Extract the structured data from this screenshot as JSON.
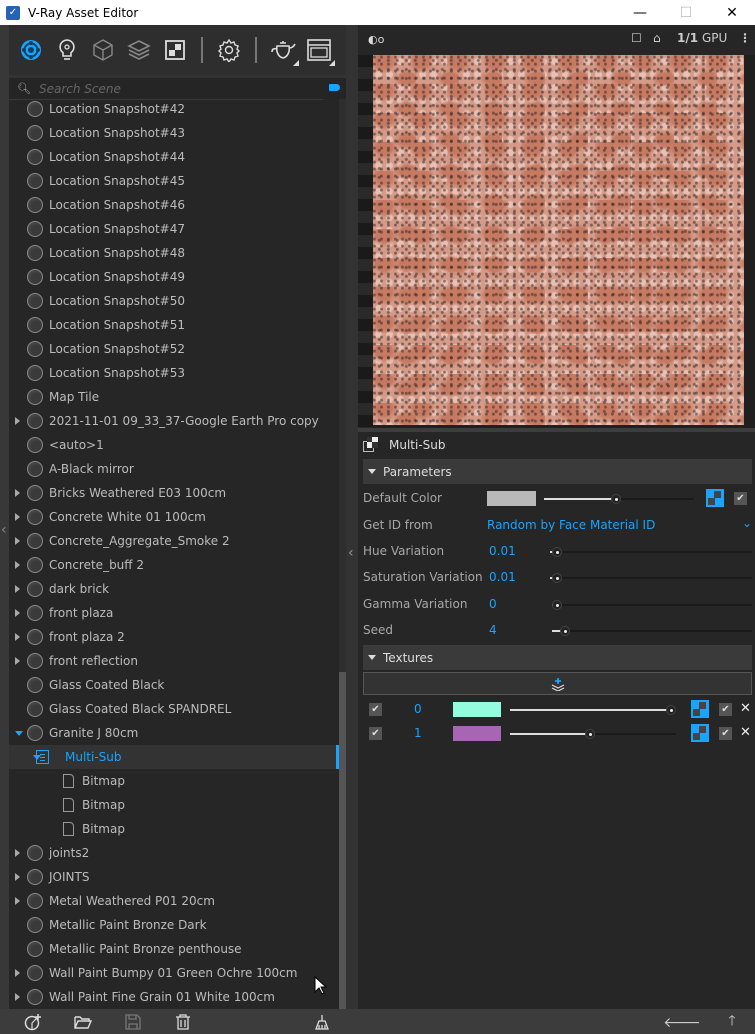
{
  "window": {
    "title": "V-Ray Asset Editor",
    "app_icon": "vray-logo-icon",
    "controls": [
      "minimize",
      "maximize",
      "close"
    ]
  },
  "toolbar": {
    "items": [
      {
        "name": "materials",
        "icon": "materials-icon",
        "active": true
      },
      {
        "name": "lights",
        "icon": "light-bulb-icon"
      },
      {
        "name": "geometry",
        "icon": "cube-icon"
      },
      {
        "name": "render-elements",
        "icon": "layers-icon"
      },
      {
        "name": "textures",
        "icon": "texture-icon"
      },
      {
        "name": "settings",
        "icon": "gear-icon"
      },
      {
        "name": "render",
        "icon": "teapot-icon"
      },
      {
        "name": "frame-buffer",
        "icon": "window-icon"
      }
    ]
  },
  "search": {
    "placeholder": "Search Scene",
    "value": ""
  },
  "tree": {
    "items": [
      {
        "label": "Location Snapshot#42",
        "level": 0,
        "expander": "none",
        "icon": "sphere"
      },
      {
        "label": "Location Snapshot#43",
        "level": 0,
        "expander": "none",
        "icon": "sphere"
      },
      {
        "label": "Location Snapshot#44",
        "level": 0,
        "expander": "none",
        "icon": "sphere"
      },
      {
        "label": "Location Snapshot#45",
        "level": 0,
        "expander": "none",
        "icon": "sphere"
      },
      {
        "label": "Location Snapshot#46",
        "level": 0,
        "expander": "none",
        "icon": "sphere"
      },
      {
        "label": "Location Snapshot#47",
        "level": 0,
        "expander": "none",
        "icon": "sphere"
      },
      {
        "label": "Location Snapshot#48",
        "level": 0,
        "expander": "none",
        "icon": "sphere"
      },
      {
        "label": "Location Snapshot#49",
        "level": 0,
        "expander": "none",
        "icon": "sphere"
      },
      {
        "label": "Location Snapshot#50",
        "level": 0,
        "expander": "none",
        "icon": "sphere"
      },
      {
        "label": "Location Snapshot#51",
        "level": 0,
        "expander": "none",
        "icon": "sphere"
      },
      {
        "label": "Location Snapshot#52",
        "level": 0,
        "expander": "none",
        "icon": "sphere"
      },
      {
        "label": "Location Snapshot#53",
        "level": 0,
        "expander": "none",
        "icon": "sphere"
      },
      {
        "label": "Map Tile",
        "level": 0,
        "expander": "none",
        "icon": "sphere"
      },
      {
        "label": "2021-11-01 09_33_37-Google Earth Pro copy",
        "level": 0,
        "expander": "collapsed",
        "icon": "sphere"
      },
      {
        "label": "<auto>1",
        "level": 0,
        "expander": "none",
        "icon": "sphere"
      },
      {
        "label": "A-Black mirror",
        "level": 0,
        "expander": "none",
        "icon": "sphere"
      },
      {
        "label": "Bricks Weathered E03 100cm",
        "level": 0,
        "expander": "collapsed",
        "icon": "sphere"
      },
      {
        "label": "Concrete White 01 100cm",
        "level": 0,
        "expander": "collapsed",
        "icon": "sphere"
      },
      {
        "label": "Concrete_Aggregate_Smoke 2",
        "level": 0,
        "expander": "collapsed",
        "icon": "sphere"
      },
      {
        "label": "Concrete_buff 2",
        "level": 0,
        "expander": "collapsed",
        "icon": "sphere"
      },
      {
        "label": "dark brick",
        "level": 0,
        "expander": "collapsed",
        "icon": "sphere"
      },
      {
        "label": "front plaza",
        "level": 0,
        "expander": "collapsed",
        "icon": "sphere"
      },
      {
        "label": "front plaza 2",
        "level": 0,
        "expander": "collapsed",
        "icon": "sphere"
      },
      {
        "label": "front reflection",
        "level": 0,
        "expander": "collapsed",
        "icon": "sphere"
      },
      {
        "label": "Glass Coated Black",
        "level": 0,
        "expander": "none",
        "icon": "sphere"
      },
      {
        "label": "Glass Coated Black SPANDREL",
        "level": 0,
        "expander": "none",
        "icon": "sphere"
      },
      {
        "label": "Granite J 80cm",
        "level": 0,
        "expander": "expanded",
        "icon": "sphere"
      },
      {
        "label": "Multi-Sub",
        "level": 1,
        "expander": "expanded",
        "icon": "multisub",
        "selected": true
      },
      {
        "label": "Bitmap",
        "level": 2,
        "expander": "none",
        "icon": "doc"
      },
      {
        "label": "Bitmap",
        "level": 2,
        "expander": "none",
        "icon": "doc"
      },
      {
        "label": "Bitmap",
        "level": 2,
        "expander": "none",
        "icon": "doc"
      },
      {
        "label": "joints2",
        "level": 0,
        "expander": "collapsed",
        "icon": "sphere"
      },
      {
        "label": "JOINTS",
        "level": 0,
        "expander": "collapsed",
        "icon": "sphere"
      },
      {
        "label": "Metal Weathered P01 20cm",
        "level": 0,
        "expander": "collapsed",
        "icon": "sphere"
      },
      {
        "label": "Metallic Paint Bronze Dark",
        "level": 0,
        "expander": "none",
        "icon": "sphere"
      },
      {
        "label": "Metallic Paint Bronze penthouse",
        "level": 0,
        "expander": "none",
        "icon": "sphere"
      },
      {
        "label": "Wall Paint Bumpy 01 Green Ochre 100cm",
        "level": 0,
        "expander": "collapsed",
        "icon": "sphere"
      },
      {
        "label": "Wall Paint Fine Grain 01 White 100cm",
        "level": 0,
        "expander": "collapsed",
        "icon": "sphere"
      }
    ]
  },
  "viewport": {
    "resolution_label": "1/1",
    "engine_label": "GPU"
  },
  "properties": {
    "title": "Multi-Sub",
    "parameters_section": "Parameters",
    "default_color": {
      "label": "Default Color",
      "swatch": "#b9b9b9",
      "slider": 0.48
    },
    "get_id_from": {
      "label": "Get ID from",
      "value": "Random by Face Material ID"
    },
    "hue_variation": {
      "label": "Hue Variation",
      "value": "0.01",
      "slider": 0.01
    },
    "saturation_variation": {
      "label": "Saturation Variation",
      "value": "0.01",
      "slider": 0.01
    },
    "gamma_variation": {
      "label": "Gamma Variation",
      "value": "0",
      "slider": 0.0
    },
    "seed": {
      "label": "Seed",
      "value": "4",
      "slider": 0.04
    },
    "textures_section": "Textures",
    "textures": [
      {
        "index": "0",
        "color": "#93fbde",
        "slider": 1.0,
        "enabled": true,
        "tex_enabled": true
      },
      {
        "index": "1",
        "color": "#a766b4",
        "slider": 0.48,
        "enabled": true,
        "tex_enabled": true
      }
    ]
  },
  "colors": {
    "accent": "#1aa3ff"
  }
}
